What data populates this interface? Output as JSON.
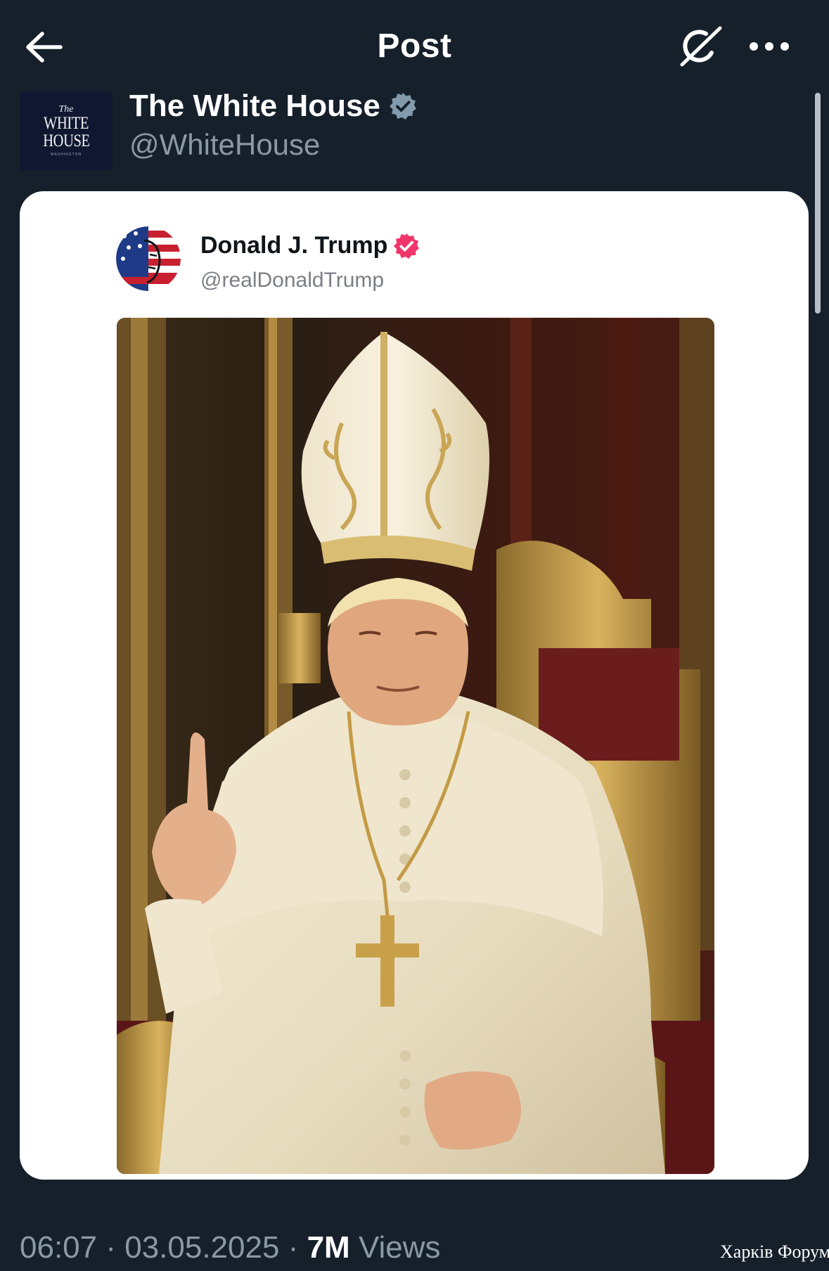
{
  "header": {
    "title": "Post",
    "back_icon": "arrow-left-icon",
    "grok_icon": "grok-icon",
    "more_icon": "more-horizontal-icon"
  },
  "author": {
    "name": "The White House",
    "handle": "@WhiteHouse",
    "verified_color": "#829aab",
    "avatar_text": {
      "the": "The",
      "line1": "WHITE",
      "line2": "HOUSE",
      "sub": "WASHINGTON"
    }
  },
  "quoted_post": {
    "name": "Donald J. Trump",
    "handle": "@realDonaldTrump",
    "verified_color": "#f0356b"
  },
  "footer": {
    "time": "06:07",
    "separator": "·",
    "date": "03.05.2025",
    "views_count": "7M",
    "views_label": "Views"
  },
  "watermark": "Харків Форум",
  "colors": {
    "background": "#15202b",
    "card": "#ffffff",
    "muted": "#8b98a5"
  }
}
